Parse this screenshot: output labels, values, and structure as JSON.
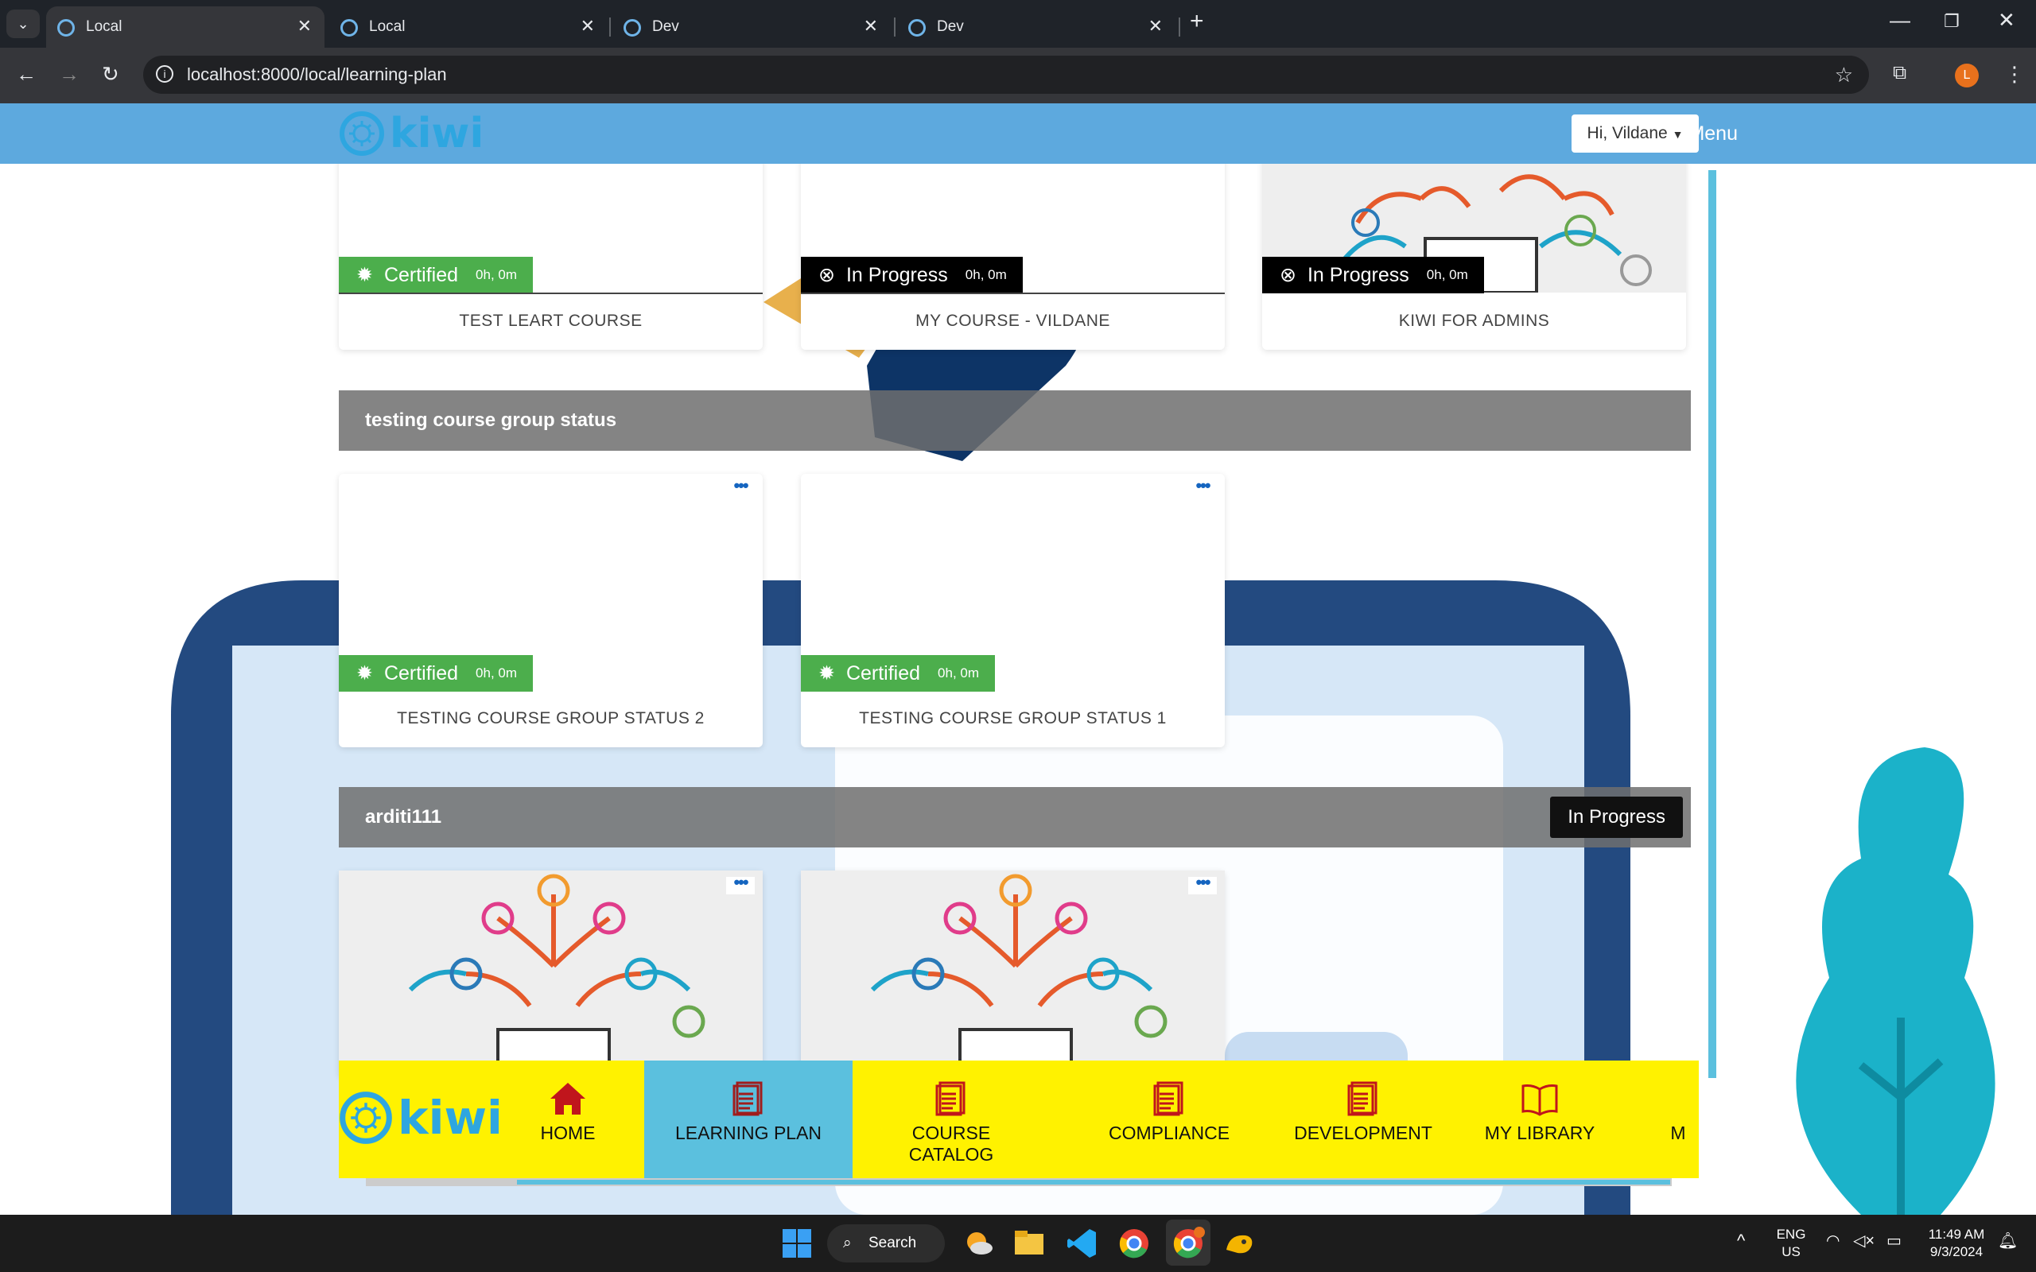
{
  "browser": {
    "tabs": [
      {
        "label": "Local"
      },
      {
        "label": "Local"
      },
      {
        "label": "Dev"
      },
      {
        "label": "Dev"
      }
    ],
    "url": "localhost:8000/local/learning-plan",
    "profile_initial": "L"
  },
  "header": {
    "logo_text": "kiwi",
    "menu_label": "Menu",
    "user_greeting": "Hi, Vildane"
  },
  "top_courses": [
    {
      "status": "Certified",
      "time": "0h, 0m",
      "title": "TEST LEART COURSE"
    },
    {
      "status": "In Progress",
      "time": "0h, 0m",
      "title": "MY COURSE - VILDANE"
    },
    {
      "status": "In Progress",
      "time": "0h, 0m",
      "title": "KIWI FOR ADMINS"
    }
  ],
  "groups": [
    {
      "name": "testing course group status",
      "status": "",
      "courses": [
        {
          "status": "Certified",
          "time": "0h, 0m",
          "title": "TESTING COURSE GROUP STATUS 2"
        },
        {
          "status": "Certified",
          "time": "0h, 0m",
          "title": "TESTING COURSE GROUP STATUS 1"
        }
      ]
    },
    {
      "name": "arditi111",
      "status": "In Progress",
      "courses": []
    }
  ],
  "bottom_nav": {
    "logo_text": "kiwi",
    "items": [
      {
        "label": "HOME",
        "icon": "home-icon"
      },
      {
        "label": "LEARNING PLAN",
        "icon": "document-icon"
      },
      {
        "label": "COURSE CATALOG",
        "icon": "document-icon"
      },
      {
        "label": "COMPLIANCE",
        "icon": "document-icon"
      },
      {
        "label": "DEVELOPMENT",
        "icon": "document-icon"
      },
      {
        "label": "MY LIBRARY",
        "icon": "book-icon"
      },
      {
        "label": "M"
      }
    ]
  },
  "taskbar": {
    "search_label": "Search",
    "language": "ENG",
    "region": "US",
    "time": "11:49 AM",
    "date": "9/3/2024"
  },
  "colors": {
    "header_blue": "#5da9de",
    "nav_yellow": "#fff200",
    "nav_active": "#5bc0de",
    "certified_green": "#4cae4c",
    "in_progress_black": "#000000"
  }
}
